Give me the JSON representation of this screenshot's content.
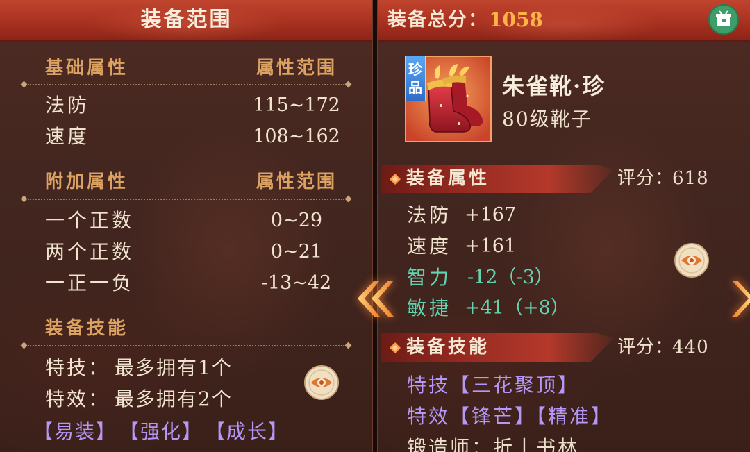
{
  "left_panel": {
    "title": "装备范围",
    "sections": [
      {
        "heading": "基础属性",
        "range_heading": "属性范围",
        "rows": [
          {
            "name": "法防",
            "range": "115~172"
          },
          {
            "name": "速度",
            "range": "108~162"
          }
        ]
      },
      {
        "heading": "附加属性",
        "range_heading": "属性范围",
        "rows": [
          {
            "name": "一个正数",
            "range": "0~29"
          },
          {
            "name": "两个正数",
            "range": "0~21"
          },
          {
            "name": "一正一负",
            "range": "-13~42"
          }
        ]
      }
    ],
    "skills": {
      "heading": "装备技能",
      "lines": [
        {
          "label": "特技：",
          "value": "最多拥有1个"
        },
        {
          "label": "特效：",
          "value": "最多拥有2个"
        }
      ],
      "tags": [
        "【易装】",
        "【强化】",
        "【成长】"
      ]
    },
    "detail_button_icon": "eye-icon"
  },
  "right_panel": {
    "total_label": "装备总分：",
    "total_score": "1058",
    "top_button_icon": "storage-box-icon",
    "item": {
      "rarity_badge": [
        "珍",
        "品"
      ],
      "name": "朱雀靴·珍",
      "description": "80级靴子",
      "image_icon": "red-boots-icon"
    },
    "attributes": {
      "heading": "装备属性",
      "score_label": "评分：",
      "score": "618",
      "rows": [
        {
          "name": "法防",
          "value": "+167",
          "color": "#f1e4cf"
        },
        {
          "name": "速度",
          "value": "+161",
          "color": "#f1e4cf"
        },
        {
          "name": "智力",
          "value": "-12（-3）",
          "color": "#63d4b1"
        },
        {
          "name": "敏捷",
          "value": "+41（+8）",
          "color": "#63d4b1"
        }
      ]
    },
    "skills": {
      "heading": "装备技能",
      "score_label": "评分：",
      "score": "440",
      "lines": [
        {
          "text": "特技【三花聚顶】",
          "color": "#b597f6"
        },
        {
          "text": "特效【锋芒】【精准】",
          "color": "#b597f6"
        },
        {
          "text": "锻造师：折丨书林",
          "color": "#ece0cb"
        }
      ]
    },
    "detail_button_icon": "eye-icon"
  },
  "navigation": {
    "prev_icon": "double-chevron-left-icon",
    "next_icon": "chevron-right-icon"
  },
  "colors": {
    "heading_gold": "#dca262",
    "text_cream": "#f1e4cf",
    "score_orange": "#ffb347",
    "bonus_teal": "#63d4b1",
    "skill_purple": "#b597f6",
    "header_red": "#a9311f",
    "badge_blue": "#2f6cc9",
    "button_green": "#3e9e69"
  }
}
